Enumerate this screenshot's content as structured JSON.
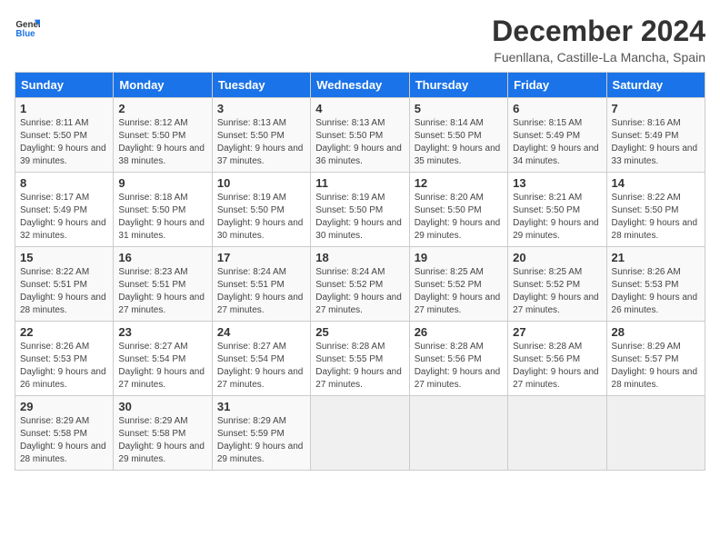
{
  "header": {
    "logo_line1": "General",
    "logo_line2": "Blue",
    "month_year": "December 2024",
    "location": "Fuenllana, Castille-La Mancha, Spain"
  },
  "weekdays": [
    "Sunday",
    "Monday",
    "Tuesday",
    "Wednesday",
    "Thursday",
    "Friday",
    "Saturday"
  ],
  "weeks": [
    [
      {
        "day": "1",
        "info": "Sunrise: 8:11 AM\nSunset: 5:50 PM\nDaylight: 9 hours and 39 minutes."
      },
      {
        "day": "2",
        "info": "Sunrise: 8:12 AM\nSunset: 5:50 PM\nDaylight: 9 hours and 38 minutes."
      },
      {
        "day": "3",
        "info": "Sunrise: 8:13 AM\nSunset: 5:50 PM\nDaylight: 9 hours and 37 minutes."
      },
      {
        "day": "4",
        "info": "Sunrise: 8:13 AM\nSunset: 5:50 PM\nDaylight: 9 hours and 36 minutes."
      },
      {
        "day": "5",
        "info": "Sunrise: 8:14 AM\nSunset: 5:50 PM\nDaylight: 9 hours and 35 minutes."
      },
      {
        "day": "6",
        "info": "Sunrise: 8:15 AM\nSunset: 5:49 PM\nDaylight: 9 hours and 34 minutes."
      },
      {
        "day": "7",
        "info": "Sunrise: 8:16 AM\nSunset: 5:49 PM\nDaylight: 9 hours and 33 minutes."
      }
    ],
    [
      {
        "day": "8",
        "info": "Sunrise: 8:17 AM\nSunset: 5:49 PM\nDaylight: 9 hours and 32 minutes."
      },
      {
        "day": "9",
        "info": "Sunrise: 8:18 AM\nSunset: 5:50 PM\nDaylight: 9 hours and 31 minutes."
      },
      {
        "day": "10",
        "info": "Sunrise: 8:19 AM\nSunset: 5:50 PM\nDaylight: 9 hours and 30 minutes."
      },
      {
        "day": "11",
        "info": "Sunrise: 8:19 AM\nSunset: 5:50 PM\nDaylight: 9 hours and 30 minutes."
      },
      {
        "day": "12",
        "info": "Sunrise: 8:20 AM\nSunset: 5:50 PM\nDaylight: 9 hours and 29 minutes."
      },
      {
        "day": "13",
        "info": "Sunrise: 8:21 AM\nSunset: 5:50 PM\nDaylight: 9 hours and 29 minutes."
      },
      {
        "day": "14",
        "info": "Sunrise: 8:22 AM\nSunset: 5:50 PM\nDaylight: 9 hours and 28 minutes."
      }
    ],
    [
      {
        "day": "15",
        "info": "Sunrise: 8:22 AM\nSunset: 5:51 PM\nDaylight: 9 hours and 28 minutes."
      },
      {
        "day": "16",
        "info": "Sunrise: 8:23 AM\nSunset: 5:51 PM\nDaylight: 9 hours and 27 minutes."
      },
      {
        "day": "17",
        "info": "Sunrise: 8:24 AM\nSunset: 5:51 PM\nDaylight: 9 hours and 27 minutes."
      },
      {
        "day": "18",
        "info": "Sunrise: 8:24 AM\nSunset: 5:52 PM\nDaylight: 9 hours and 27 minutes."
      },
      {
        "day": "19",
        "info": "Sunrise: 8:25 AM\nSunset: 5:52 PM\nDaylight: 9 hours and 27 minutes."
      },
      {
        "day": "20",
        "info": "Sunrise: 8:25 AM\nSunset: 5:52 PM\nDaylight: 9 hours and 27 minutes."
      },
      {
        "day": "21",
        "info": "Sunrise: 8:26 AM\nSunset: 5:53 PM\nDaylight: 9 hours and 26 minutes."
      }
    ],
    [
      {
        "day": "22",
        "info": "Sunrise: 8:26 AM\nSunset: 5:53 PM\nDaylight: 9 hours and 26 minutes."
      },
      {
        "day": "23",
        "info": "Sunrise: 8:27 AM\nSunset: 5:54 PM\nDaylight: 9 hours and 27 minutes."
      },
      {
        "day": "24",
        "info": "Sunrise: 8:27 AM\nSunset: 5:54 PM\nDaylight: 9 hours and 27 minutes."
      },
      {
        "day": "25",
        "info": "Sunrise: 8:28 AM\nSunset: 5:55 PM\nDaylight: 9 hours and 27 minutes."
      },
      {
        "day": "26",
        "info": "Sunrise: 8:28 AM\nSunset: 5:56 PM\nDaylight: 9 hours and 27 minutes."
      },
      {
        "day": "27",
        "info": "Sunrise: 8:28 AM\nSunset: 5:56 PM\nDaylight: 9 hours and 27 minutes."
      },
      {
        "day": "28",
        "info": "Sunrise: 8:29 AM\nSunset: 5:57 PM\nDaylight: 9 hours and 28 minutes."
      }
    ],
    [
      {
        "day": "29",
        "info": "Sunrise: 8:29 AM\nSunset: 5:58 PM\nDaylight: 9 hours and 28 minutes."
      },
      {
        "day": "30",
        "info": "Sunrise: 8:29 AM\nSunset: 5:58 PM\nDaylight: 9 hours and 29 minutes."
      },
      {
        "day": "31",
        "info": "Sunrise: 8:29 AM\nSunset: 5:59 PM\nDaylight: 9 hours and 29 minutes."
      },
      {
        "day": "",
        "info": ""
      },
      {
        "day": "",
        "info": ""
      },
      {
        "day": "",
        "info": ""
      },
      {
        "day": "",
        "info": ""
      }
    ]
  ]
}
